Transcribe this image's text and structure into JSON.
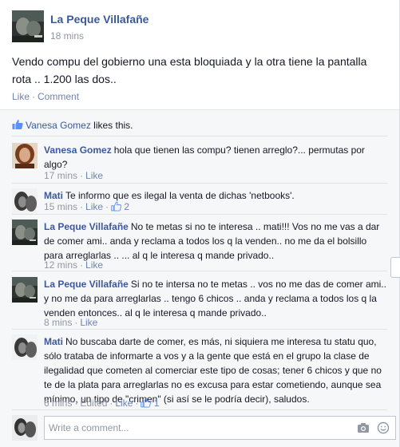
{
  "post": {
    "author": "La Peque Villafañe",
    "time": "18 mins",
    "body": "Vendo compu del gobierno una esta bloquiada y la otra tiene la pantalla rota .. 1.200 las dos..",
    "actions": {
      "like": "Like",
      "comment": "Comment"
    }
  },
  "likes": {
    "name": "Vanesa Gomez",
    "suffix": " likes this."
  },
  "comments": [
    {
      "author": "Vanesa Gomez",
      "text": "hola que tienen las compu? tienen arreglo?... permutas por algo?",
      "time": "17 mins",
      "like": "Like"
    },
    {
      "author": "Mati",
      "text": "Te informo que es ilegal la venta de dichas 'netbooks'.",
      "time": "15 mins",
      "like": "Like",
      "like_count": "2"
    },
    {
      "author": "La Peque Villafañe",
      "text": "No te metas si no te interesa .. mati!!! Vos no me vas a dar de comer ami.. anda y reclama a todos los q la venden.. no me da el bolsillo para arreglarlas .. ... al q le interesa q mande privado..",
      "time": "12 mins",
      "like": "Like"
    },
    {
      "author": "La Peque Villafañe",
      "text": "Si no te intersa no te metas .. vos no me das de comer ami.. y no me da para arreglarlas .. tengo 6 chicos .. anda y reclama a todos los q la venden entonces.. al q le interesa q mande privado..",
      "time": "8 mins",
      "like": "Like"
    },
    {
      "author": "Mati",
      "text": "No buscaba darte de comer, es más, ni siquiera me interesa tu statu quo, sólo trataba de informarte a vos y a la gente que está en el grupo la clase de ilegalidad que cometen al comerciar este tipo de cosas; tener 6 chicos y que no te de la plata para arreglarlas no es excusa para estar cometiendo, aunque sea mínimo, un tipo de \"crimen\" (si así se le podría decir), saludos.",
      "time": "6 mins",
      "edited": "Edited",
      "like": "Like",
      "like_count": "1"
    }
  ],
  "compose": {
    "placeholder": "Write a comment..."
  },
  "colors": {
    "link": "#3b5998",
    "meta": "#9197a3",
    "action": "#6d84b4",
    "feedback_bg": "#f6f7f8"
  },
  "icons": [
    "thumbs-up-icon",
    "camera-icon",
    "smile-icon"
  ]
}
